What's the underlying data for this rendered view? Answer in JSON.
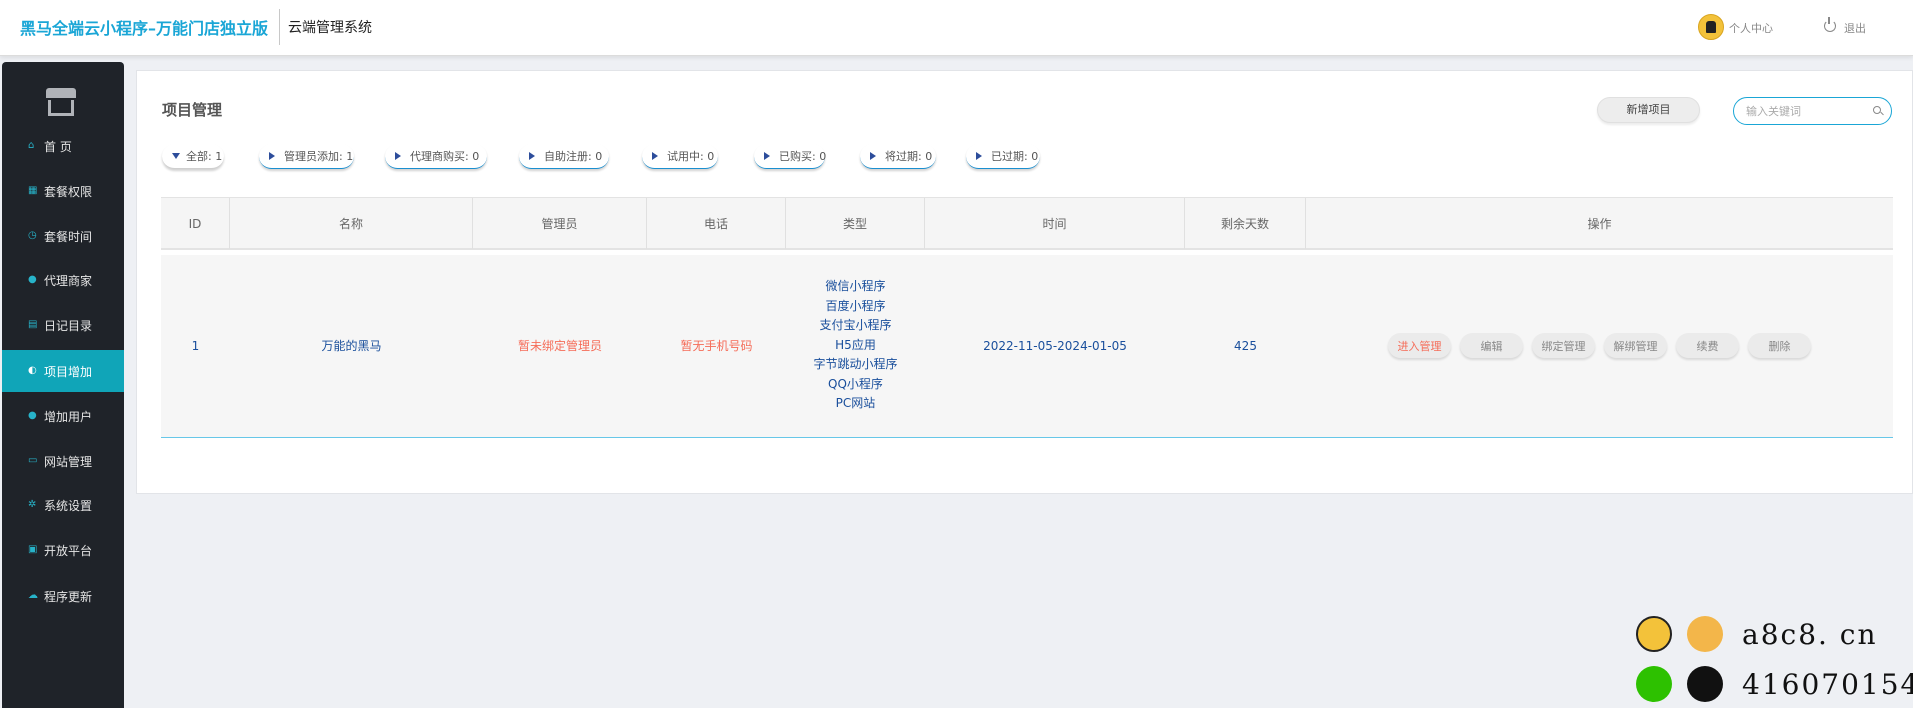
{
  "header": {
    "brand": "黑马全端云小程序–万能门店独立版",
    "system_name": "云端管理系统",
    "user_center": "个人中心",
    "logout": "退出"
  },
  "sidebar": {
    "items": [
      {
        "label": "首 页",
        "icon": "home-icon",
        "glyph": "⌂"
      },
      {
        "label": "套餐权限",
        "icon": "grid-icon",
        "glyph": "▦"
      },
      {
        "label": "套餐时间",
        "icon": "clock-icon",
        "glyph": "◷"
      },
      {
        "label": "代理商家",
        "icon": "user-icon",
        "glyph": "●"
      },
      {
        "label": "日记目录",
        "icon": "book-icon",
        "glyph": "▤"
      },
      {
        "label": "项目增加",
        "icon": "project-icon",
        "glyph": "◐"
      },
      {
        "label": "增加用户",
        "icon": "add-user-icon",
        "glyph": "●"
      },
      {
        "label": "网站管理",
        "icon": "site-icon",
        "glyph": "▭"
      },
      {
        "label": "系统设置",
        "icon": "gear-icon",
        "glyph": "✲"
      },
      {
        "label": "开放平台",
        "icon": "platform-icon",
        "glyph": "▣"
      },
      {
        "label": "程序更新",
        "icon": "cloud-icon",
        "glyph": "☁"
      }
    ],
    "active_index": 5
  },
  "main": {
    "title": "项目管理",
    "add_button": "新增项目",
    "search_placeholder": "输入关键词",
    "filters": [
      {
        "label": "全部: 1"
      },
      {
        "label": "管理员添加: 1"
      },
      {
        "label": "代理商购买: 0"
      },
      {
        "label": "自助注册: 0"
      },
      {
        "label": "试用中: 0"
      },
      {
        "label": "已购买: 0"
      },
      {
        "label": "将过期: 0"
      },
      {
        "label": "已过期: 0"
      }
    ],
    "table": {
      "columns": [
        "ID",
        "名称",
        "管理员",
        "电话",
        "类型",
        "时间",
        "剩余天数",
        "操作"
      ],
      "rows": [
        {
          "id": "1",
          "name": "万能的黑马",
          "admin": "暂未绑定管理员",
          "phone": "暂无手机号码",
          "types": [
            "微信小程序",
            "百度小程序",
            "支付宝小程序",
            "H5应用",
            "字节跳动小程序",
            "QQ小程序",
            "PC网站"
          ],
          "time": "2022-11-05-2024-01-05",
          "days_left": "425",
          "actions": [
            "进入管理",
            "编辑",
            "绑定管理",
            "解绑管理",
            "续费",
            "删除"
          ]
        }
      ]
    }
  },
  "watermark": {
    "site": "a8c8. cn",
    "qq": "416070154"
  }
}
